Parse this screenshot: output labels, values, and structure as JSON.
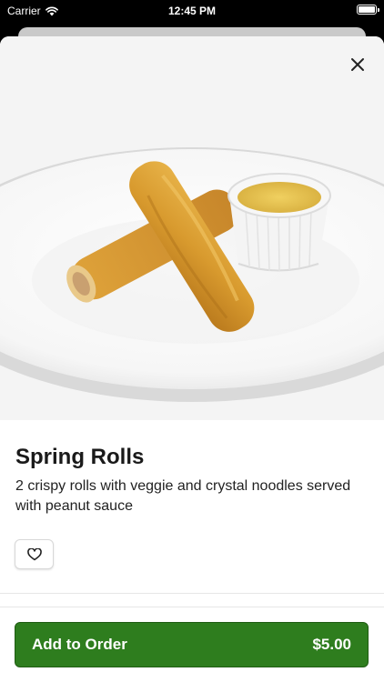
{
  "status_bar": {
    "carrier": "Carrier",
    "time": "12:45 PM"
  },
  "item": {
    "image_description_icon": "spring-rolls-photo",
    "name": "Spring Rolls",
    "description": "2 crispy rolls with veggie and crystal noodles served with peanut sauce"
  },
  "actions": {
    "close_icon": "close-icon",
    "favorite_icon": "heart-icon",
    "add_label": "Add to Order",
    "price": "$5.00"
  },
  "colors": {
    "accent": "#2e7d1e",
    "text": "#1a1a1a"
  }
}
